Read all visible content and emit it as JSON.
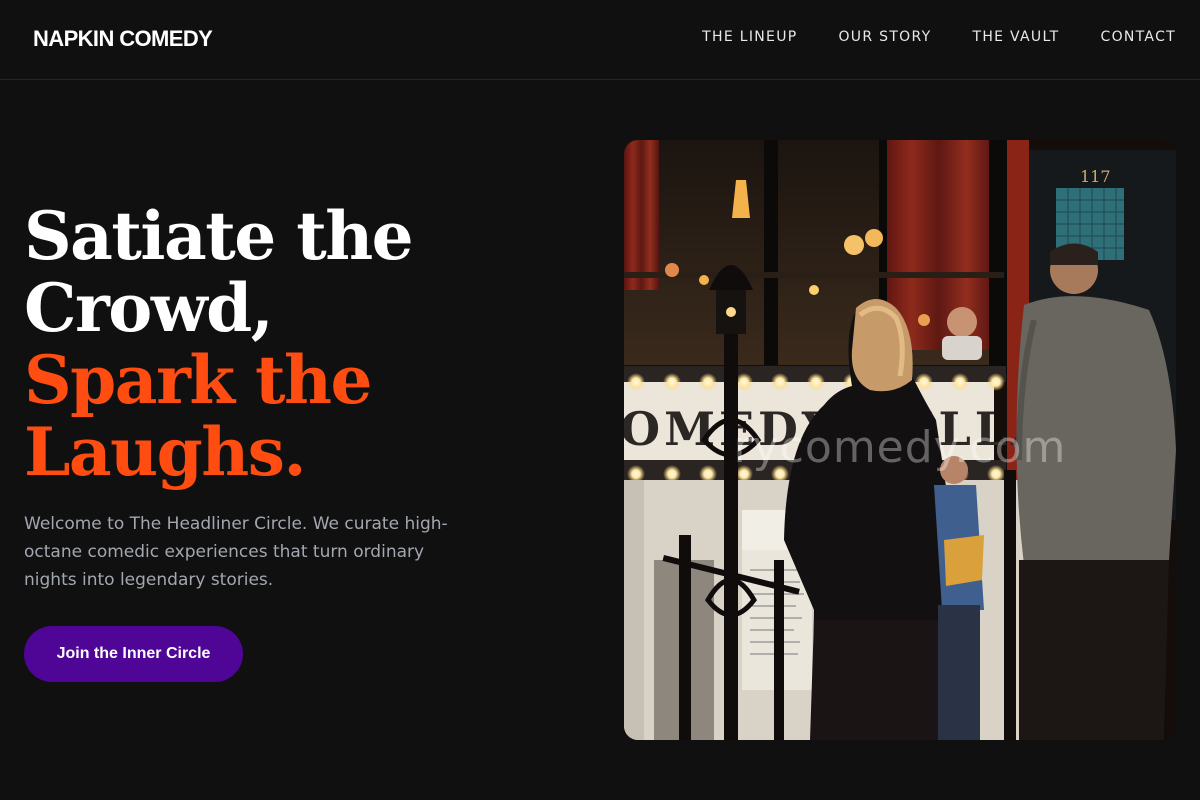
{
  "brand": {
    "name": "NAPKIN COMEDY"
  },
  "nav": {
    "items": [
      {
        "label": "THE LINEUP"
      },
      {
        "label": "OUR STORY"
      },
      {
        "label": "THE VAULT"
      },
      {
        "label": "CONTACT"
      }
    ]
  },
  "hero": {
    "headline_lines": [
      "Satiate the",
      "Crowd,"
    ],
    "accent_lines": [
      "Spark the",
      "Laughs."
    ],
    "lead": "Welcome to The Headliner Circle. We curate high-octane comedic experiences that turn ordinary nights into legendary stories.",
    "cta_label": "Join the Inner Circle"
  },
  "photo": {
    "watermark": "rycomedy.com",
    "door_number": "117",
    "marquee_text": "OMEDY CELLAR"
  },
  "colors": {
    "background": "#101010",
    "accent_orange": "#ff4d12",
    "cta_purple": "#4f0596",
    "body_text": "#a3a7b0"
  }
}
